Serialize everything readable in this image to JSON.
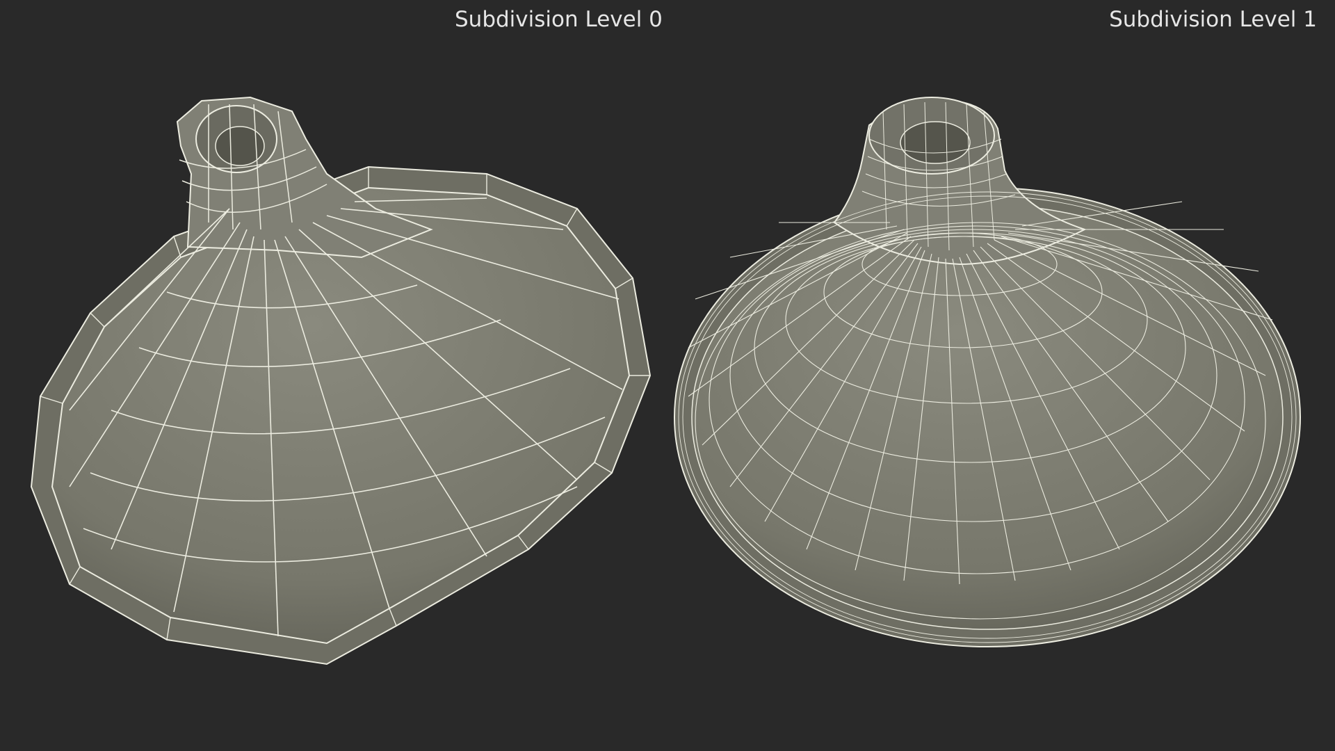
{
  "labels": {
    "left": "Subdivision Level 0",
    "right": "Subdivision Level 1"
  },
  "colors": {
    "background": "#292929",
    "surface": "#7a7a6e",
    "wire": "#f2f2e6",
    "text": "#e6e6e6"
  },
  "models": [
    {
      "name": "tagine-lid-level-0",
      "subdivision_level": 0
    },
    {
      "name": "tagine-lid-level-1",
      "subdivision_level": 1
    }
  ]
}
